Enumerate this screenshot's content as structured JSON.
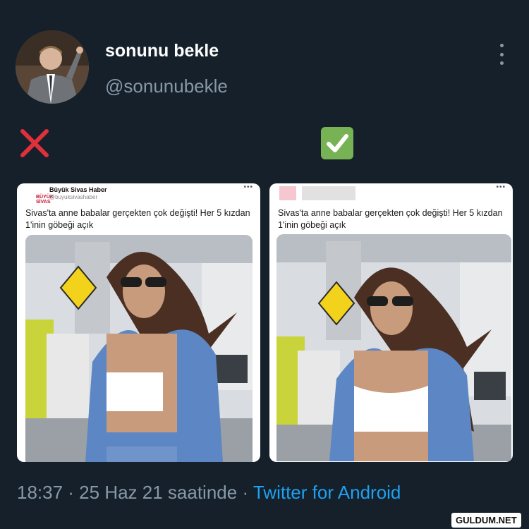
{
  "tweet": {
    "display_name": "sonunu bekle",
    "handle": "@sonunubekle",
    "timestamp": "18:37 · 25 Haz 21 saatinde",
    "separator": " · ",
    "source": "Twitter for Android"
  },
  "marks": {
    "wrong_icon": "cross-mark-icon",
    "right_icon": "check-mark-icon",
    "wrong_color": "#e0303a",
    "right_color": "#77b255"
  },
  "left_card": {
    "account_name": "Büyük Sivas Haber",
    "account_handle": "@buyuksivashaber",
    "logo_text": "BÜYÜK SİVAS",
    "menu": "•••",
    "text": "Sivas'ta anne babalar gerçekten çok değişti! Her 5 kızdan 1'inin göbeği açık"
  },
  "right_card": {
    "menu": "•••",
    "text": "Sivas'ta anne babalar gerçekten çok değişti! Her 5 kızdan 1'inin göbeği açık"
  },
  "watermark": "GULDUM.NET",
  "colors": {
    "background": "#15202b",
    "name": "#ffffff",
    "muted": "#8899a6",
    "link": "#1da1f2"
  }
}
